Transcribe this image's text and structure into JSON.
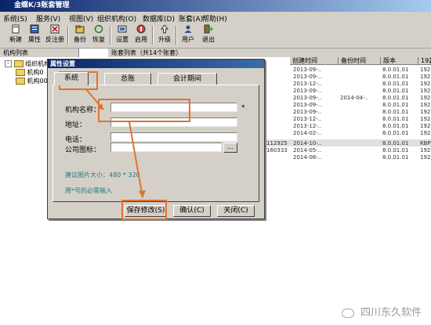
{
  "window": {
    "title": "金蝶K/3账套管理"
  },
  "menu": [
    "系统(S)",
    "服务(V)",
    "视图(V)",
    "组织机构(O)",
    "数据库(D)",
    "账套(A)",
    "帮助(H)"
  ],
  "toolbar": [
    {
      "label": "新建",
      "icon": "new-icon"
    },
    {
      "label": "属性",
      "icon": "properties-icon"
    },
    {
      "label": "反注册",
      "icon": "unregister-icon"
    },
    {
      "label": "备份",
      "icon": "backup-icon"
    },
    {
      "label": "恢复",
      "icon": "restore-icon"
    },
    {
      "label": "设置",
      "icon": "settings-icon"
    },
    {
      "label": "启用",
      "icon": "enable-icon"
    },
    {
      "label": "升级",
      "icon": "upgrade-icon"
    },
    {
      "label": "用户",
      "icon": "user-icon"
    },
    {
      "label": "退出",
      "icon": "exit-icon"
    }
  ],
  "left_pane": {
    "header": "机构列表",
    "root": "组织机构",
    "children": [
      "机构0",
      "机构00"
    ]
  },
  "list": {
    "tab": "账套列表（共14个账套）",
    "columns": [
      "创建时间",
      "备份时间",
      "版本",
      "192"
    ],
    "rows": [
      {
        "created": "2013-09-..",
        "backup": "",
        "version": "8.0.01.01",
        "ip": "192."
      },
      {
        "created": "2013-09-..",
        "backup": "",
        "version": "8.0.01.01",
        "ip": "192."
      },
      {
        "created": "2013-12-..",
        "backup": "",
        "version": "8.0.01.01",
        "ip": "192."
      },
      {
        "created": "2013-09-..",
        "backup": "",
        "version": "8.0.01.01",
        "ip": "192."
      },
      {
        "created": "2013-09-..",
        "backup": "2014-04-..",
        "version": "8.0.01.01",
        "ip": "192."
      },
      {
        "created": "2013-09-..",
        "backup": "",
        "version": "8.0.01.01",
        "ip": "192."
      },
      {
        "created": "2013-09-..",
        "backup": "",
        "version": "8.0.01.01",
        "ip": "192."
      },
      {
        "created": "2013-12-..",
        "backup": "",
        "version": "8.0.01.01",
        "ip": "192."
      },
      {
        "created": "2013-12-..",
        "backup": "",
        "version": "8.0.01.01",
        "ip": "192."
      },
      {
        "created": "2014-02-..",
        "backup": "",
        "version": "8.0.01.01",
        "ip": "192."
      },
      {
        "code": "112925",
        "created": "2014-10-..",
        "backup": "",
        "version": "8.0.01.01",
        "ip": "KBP:"
      },
      {
        "code": "160333",
        "created": "2014-05-..",
        "backup": "",
        "version": "8.0.01.01",
        "ip": "192."
      },
      {
        "created": "2014-08-..",
        "backup": "",
        "version": "8.0.01.01",
        "ip": "192."
      }
    ]
  },
  "dialog": {
    "title": "属性设置",
    "tabs": [
      "系统",
      "总账",
      "会计期间"
    ],
    "fields": {
      "name_label": "机构名称：",
      "address_label": "地址：",
      "phone_label": "电话：",
      "logo_label": "公司图标：",
      "required_mark": "*"
    },
    "hint_size": "建议图片大小：480 * 320",
    "hint_required": "用*号的必需输入",
    "buttons": {
      "save": "保存修改(S)",
      "ok": "确认(C)",
      "close": "关闭(C)"
    }
  },
  "watermark": "四川东久软件",
  "colors": {
    "annotation": "#e2722c",
    "titlebar": "#0a246a"
  }
}
